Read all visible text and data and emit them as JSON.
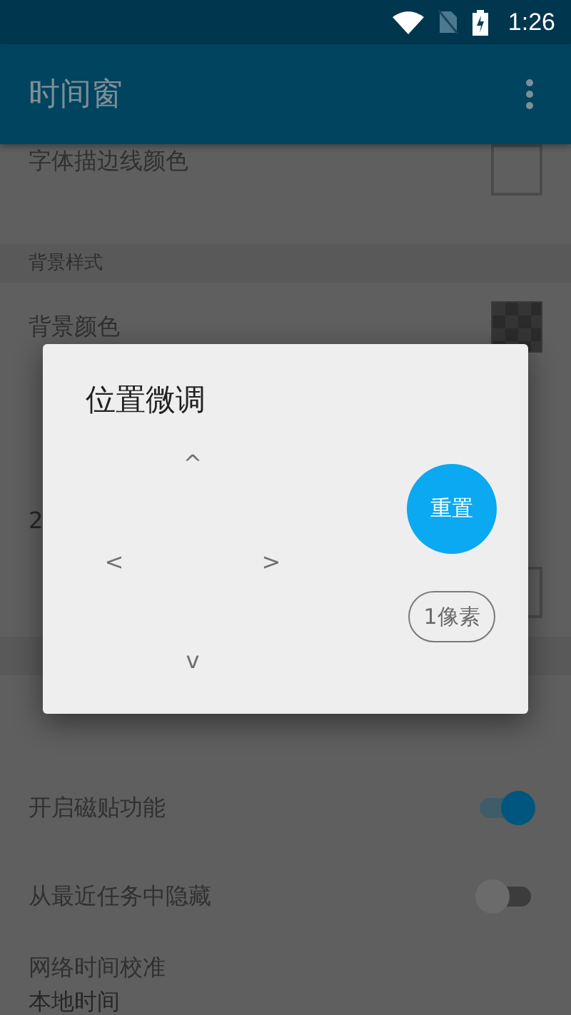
{
  "status_bar": {
    "time": "1:26"
  },
  "app_bar": {
    "title": "时间窗"
  },
  "settings": [
    {
      "kind": "color",
      "title": "字体描边线颜色",
      "checkered": false
    },
    {
      "kind": "header",
      "title": "背景样式"
    },
    {
      "kind": "color",
      "title": "背景颜色",
      "checkered": true
    },
    {
      "kind": "text"
    },
    {
      "kind": "text",
      "subtitle": "2"
    },
    {
      "kind": "color",
      "checkered": false
    },
    {
      "kind": "header"
    },
    {
      "kind": "text"
    },
    {
      "kind": "switch",
      "title": "开启磁贴功能",
      "on": true
    },
    {
      "kind": "switch",
      "title": "从最近任务中隐藏",
      "on": false
    },
    {
      "kind": "text",
      "title": "网络时间校准",
      "subtitle": "本地时间"
    }
  ],
  "dialog": {
    "title": "位置微调",
    "arrows": [
      "^",
      "<",
      ">",
      "v"
    ],
    "reset": "重置",
    "step": "1像素"
  }
}
